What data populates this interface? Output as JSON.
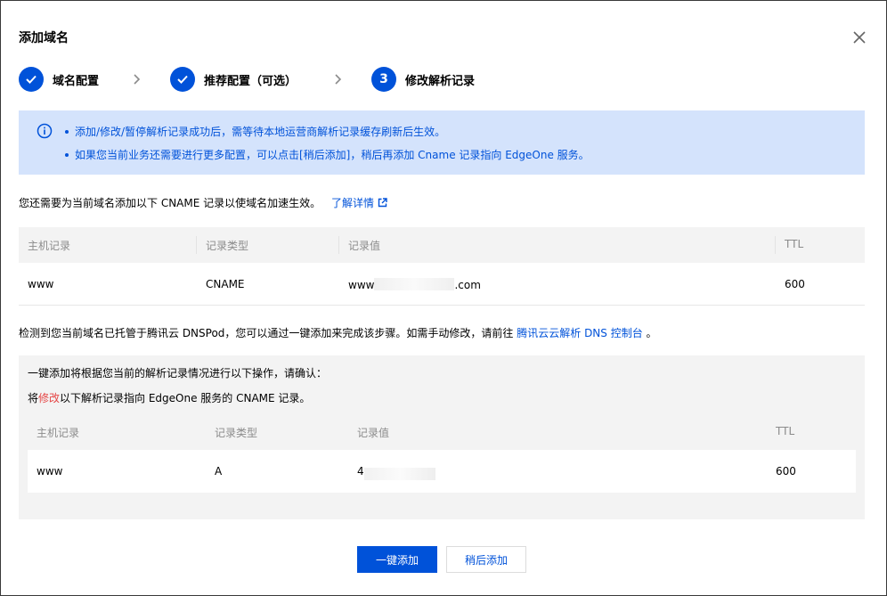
{
  "dialog": {
    "title": "添加域名"
  },
  "steps": [
    {
      "label": "域名配置",
      "state": "done"
    },
    {
      "label": "推荐配置（可选）",
      "state": "done"
    },
    {
      "label": "修改解析记录",
      "state": "current",
      "number": "3"
    }
  ],
  "info": {
    "lines": [
      "添加/修改/暂停解析记录成功后，需等待本地运营商解析记录缓存刷新后生效。",
      "如果您当前业务还需要进行更多配置，可以点击[稍后添加]，稍后再添加 Cname 记录指向 EdgeOne 服务。"
    ]
  },
  "cname_note": {
    "text": "您还需要为当前域名添加以下 CNAME 记录以使域名加速生效。",
    "link": "了解详情"
  },
  "cname_table": {
    "headers": [
      "主机记录",
      "记录类型",
      "记录值",
      "TTL"
    ],
    "row": {
      "host": "www",
      "type": "CNAME",
      "value_prefix": "www",
      "value_suffix": ".com",
      "ttl": "600"
    }
  },
  "dnspod_note": {
    "text": "检测到您当前域名已托管于腾讯云 DNSPod，您可以通过一键添加来完成该步骤。如需手动修改，请前往",
    "link": "腾讯云云解析 DNS 控制台",
    "suffix": "。"
  },
  "confirm": {
    "line1": "一键添加将根据您当前的解析记录情况进行以下操作，请确认：",
    "line2_prefix": "将",
    "line2_highlight": "修改",
    "line2_suffix": "以下解析记录指向 EdgeOne 服务的 CNAME 记录。",
    "table": {
      "headers": [
        "主机记录",
        "记录类型",
        "记录值",
        "TTL"
      ],
      "row": {
        "host": "www",
        "type": "A",
        "value_prefix": "4",
        "ttl": "600"
      }
    }
  },
  "buttons": {
    "primary": "一键添加",
    "secondary": "稍后添加"
  },
  "colors": {
    "brand": "#0052d9",
    "info_bg": "#d4e3fc",
    "highlight": "#e54545"
  }
}
